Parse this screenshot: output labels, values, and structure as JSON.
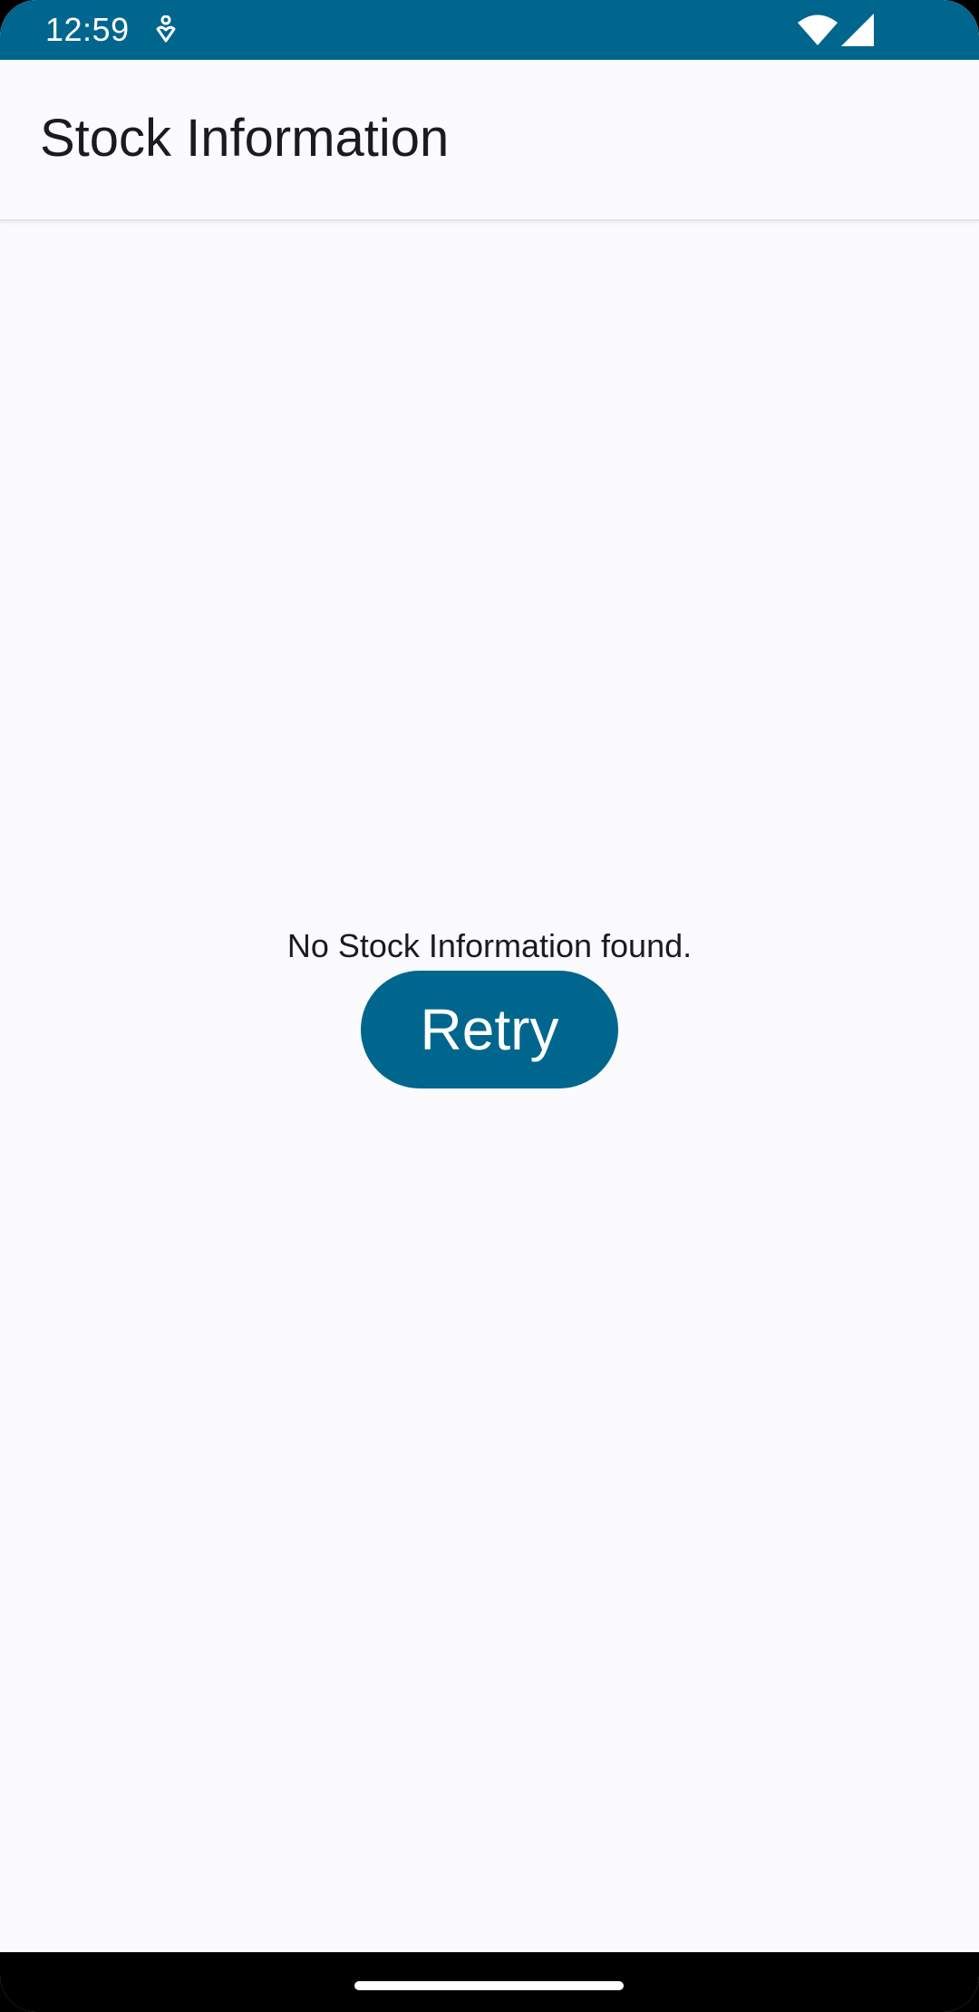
{
  "status_bar": {
    "time": "12:59",
    "icons": [
      "notification-icon",
      "wifi-icon",
      "signal-icon"
    ],
    "color": "#00668D"
  },
  "app_bar": {
    "title": "Stock Information"
  },
  "main": {
    "empty_message": "No Stock Information found.",
    "retry_label": "Retry"
  },
  "nav_bar": {
    "icons": [
      "home-handle"
    ]
  },
  "colors": {
    "primary": "#00668D",
    "background": "#FBFBFE",
    "on_background": "#1B1B1F",
    "on_primary": "#FFFFFF"
  }
}
